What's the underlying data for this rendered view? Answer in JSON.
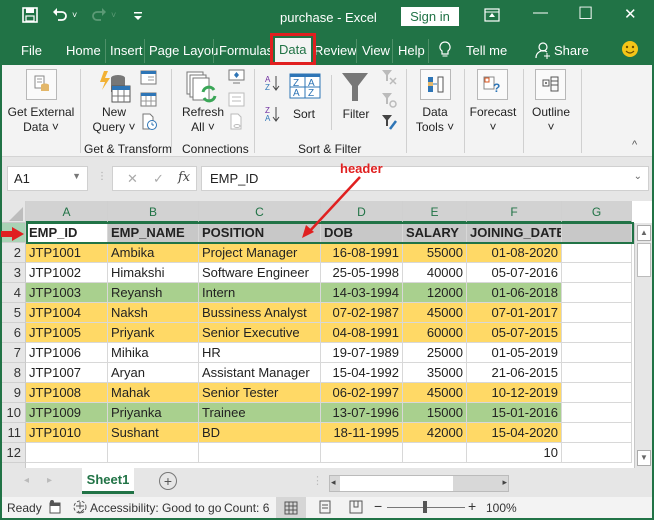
{
  "titlebar": {
    "doc_title": "purchase  -  Excel",
    "sign_in": "Sign in",
    "icons": [
      "save-icon",
      "undo-icon",
      "redo-icon",
      "customize-qat-icon",
      "ribbon-display-icon",
      "minimize-icon",
      "maximize-icon",
      "close-icon"
    ],
    "glyphs": {
      "save": "🖫",
      "undo": "↶",
      "redo": "↷",
      "drop": "˅",
      "qat": "⩡",
      "ribbon_display": "⊡",
      "minimize": "—",
      "maximize": "☐",
      "close": "✕"
    }
  },
  "tabs": [
    {
      "label": "File"
    },
    {
      "label": "Home"
    },
    {
      "label": "Insert"
    },
    {
      "label": "Page Layou"
    },
    {
      "label": "Formulas"
    },
    {
      "label": "Data",
      "active": true
    },
    {
      "label": "Review"
    },
    {
      "label": "View"
    },
    {
      "label": "Help"
    },
    {
      "label": "Tell me"
    },
    {
      "label": "Share"
    }
  ],
  "ribbon": {
    "get_external_data": "Get External\nData ˅",
    "get_external_data_l1": "Get External",
    "get_external_data_l2": "Data ˅",
    "new_query_l1": "New",
    "new_query_l2": "Query ˅",
    "refresh_all_l1": "Refresh",
    "refresh_all_l2": "All ˅",
    "sort": "Sort",
    "filter": "Filter",
    "data_tools_l1": "Data",
    "data_tools_l2": "Tools ˅",
    "forecast": "Forecast",
    "forecast_dd": "˅",
    "outline": "Outline",
    "outline_dd": "˅",
    "groups": {
      "get_transform": "Get & Transform",
      "connections": "Connections",
      "sort_filter": "Sort & Filter"
    },
    "collapse": "^"
  },
  "formula_bar": {
    "name_box": "A1",
    "cancel": "✕",
    "enter": "✓",
    "fx": "fx",
    "formula": "EMP_ID"
  },
  "annotation": {
    "label": "header",
    "color": "#e02020"
  },
  "grid": {
    "columns": [
      "A",
      "B",
      "C",
      "D",
      "E",
      "F",
      "G"
    ],
    "header_row": [
      "EMP_ID",
      "EMP_NAME",
      "POSITION",
      "DOB",
      "SALARY",
      "JOINING_DATE"
    ],
    "rows": [
      {
        "n": "2",
        "fill": "y",
        "cells": [
          "JTP1001",
          "Ambika",
          "Project Manager",
          "16-08-1991",
          "55000",
          "01-08-2020"
        ]
      },
      {
        "n": "3",
        "fill": "",
        "cells": [
          "JTP1002",
          "Himakshi",
          "Software Engineer",
          "25-05-1998",
          "40000",
          "05-07-2016"
        ]
      },
      {
        "n": "4",
        "fill": "g",
        "cells": [
          "JTP1003",
          "Reyansh",
          "Intern",
          "14-03-1994",
          "12000",
          "01-06-2018"
        ]
      },
      {
        "n": "5",
        "fill": "y",
        "cells": [
          "JTP1004",
          "Naksh",
          "Bussiness Analyst",
          "07-02-1987",
          "45000",
          "07-01-2017"
        ]
      },
      {
        "n": "6",
        "fill": "y",
        "cells": [
          "JTP1005",
          "Priyank",
          "Senior Executive",
          "04-08-1991",
          "60000",
          "05-07-2015"
        ]
      },
      {
        "n": "7",
        "fill": "",
        "cells": [
          "JTP1006",
          "Mihika",
          "HR",
          "19-07-1989",
          "25000",
          "01-05-2019"
        ]
      },
      {
        "n": "8",
        "fill": "",
        "cells": [
          "JTP1007",
          "Aryan",
          "Assistant Manager",
          "15-04-1992",
          "35000",
          "21-06-2015"
        ]
      },
      {
        "n": "9",
        "fill": "y",
        "cells": [
          "JTP1008",
          "Mahak",
          "Senior Tester",
          "06-02-1997",
          "45000",
          "10-12-2019"
        ]
      },
      {
        "n": "10",
        "fill": "g",
        "cells": [
          "JTP1009",
          "Priyanka",
          "Trainee",
          "13-07-1996",
          "15000",
          "15-01-2016"
        ]
      },
      {
        "n": "11",
        "fill": "y",
        "cells": [
          "JTP1010",
          "Sushant",
          "BD",
          "18-11-1995",
          "42000",
          "15-04-2020"
        ]
      },
      {
        "n": "12",
        "fill": "",
        "cells": [
          "",
          "",
          "",
          "",
          "",
          "10"
        ]
      }
    ],
    "colors": {
      "yellow": "#ffd966",
      "green": "#a9d08e",
      "header": "#c8c8c8",
      "accent": "#217346"
    }
  },
  "sheets": {
    "tabs": [
      "Sheet1"
    ],
    "add": "+"
  },
  "status": {
    "ready": "Ready",
    "accessibility": "Accessibility: Good to go",
    "count": "Count: 6",
    "zoom_minus": "−",
    "zoom_plus": "+",
    "zoom": "100%",
    "zoom_level_percent": 100
  }
}
